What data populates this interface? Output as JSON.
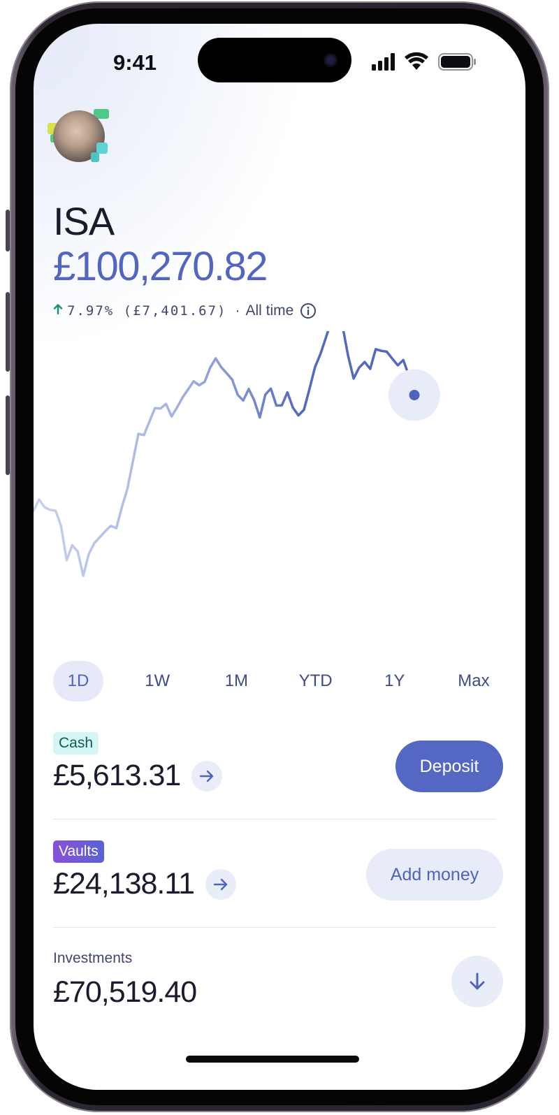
{
  "status_bar": {
    "time": "9:41"
  },
  "account": {
    "title": "ISA",
    "balance": "£100,270.82",
    "performance": {
      "direction_icon": "arrow-up-icon",
      "change": "7.97% (£7,401.67)",
      "separator": "·",
      "period": "All time"
    }
  },
  "chart_data": {
    "type": "line",
    "title": "",
    "xlabel": "",
    "ylabel": "",
    "series": [
      {
        "name": "",
        "color": "#5368bf",
        "values": [
          54.3,
          59.7,
          56.0,
          54.7,
          54.3,
          46.9,
          30.7,
          37.8,
          34.9,
          23.3,
          33.6,
          38.8,
          41.7,
          44.6,
          47.1,
          46.0,
          56.0,
          64.8,
          77.9,
          91.0,
          90.4,
          96.9,
          103.3,
          103.1,
          105.3,
          99.3,
          103.6,
          108.4,
          112.2,
          116.1,
          114.2,
          115.8,
          122.6,
          127.0,
          122.8,
          119.9,
          116.9,
          109.6,
          106.9,
          112.4,
          106.9,
          98.8,
          109.7,
          112.6,
          104.5,
          104.6,
          110.8,
          103.5,
          99.8,
          102.5,
          112.4,
          122.8,
          129.2,
          137.1,
          145.2,
          145.8,
          142.3,
          128.2,
          117.4,
          122.6,
          125.3,
          122.0,
          131.4,
          130.6,
          130.2,
          126.9,
          123.7,
          126.2,
          118.8,
          109.5
        ]
      }
    ],
    "selected_range": "1D"
  },
  "ranges": [
    "1D",
    "1W",
    "1M",
    "YTD",
    "1Y",
    "Max"
  ],
  "cash": {
    "label": "Cash",
    "amount": "£5,613.31",
    "action": "Deposit"
  },
  "vaults": {
    "label": "Vaults",
    "amount": "£24,138.11",
    "action": "Add money"
  },
  "investments": {
    "label": "Investments",
    "amount": "£70,519.40"
  },
  "colors": {
    "accent": "#5468c3",
    "text": "#1b1b2e",
    "positive": "#1b8f72"
  }
}
